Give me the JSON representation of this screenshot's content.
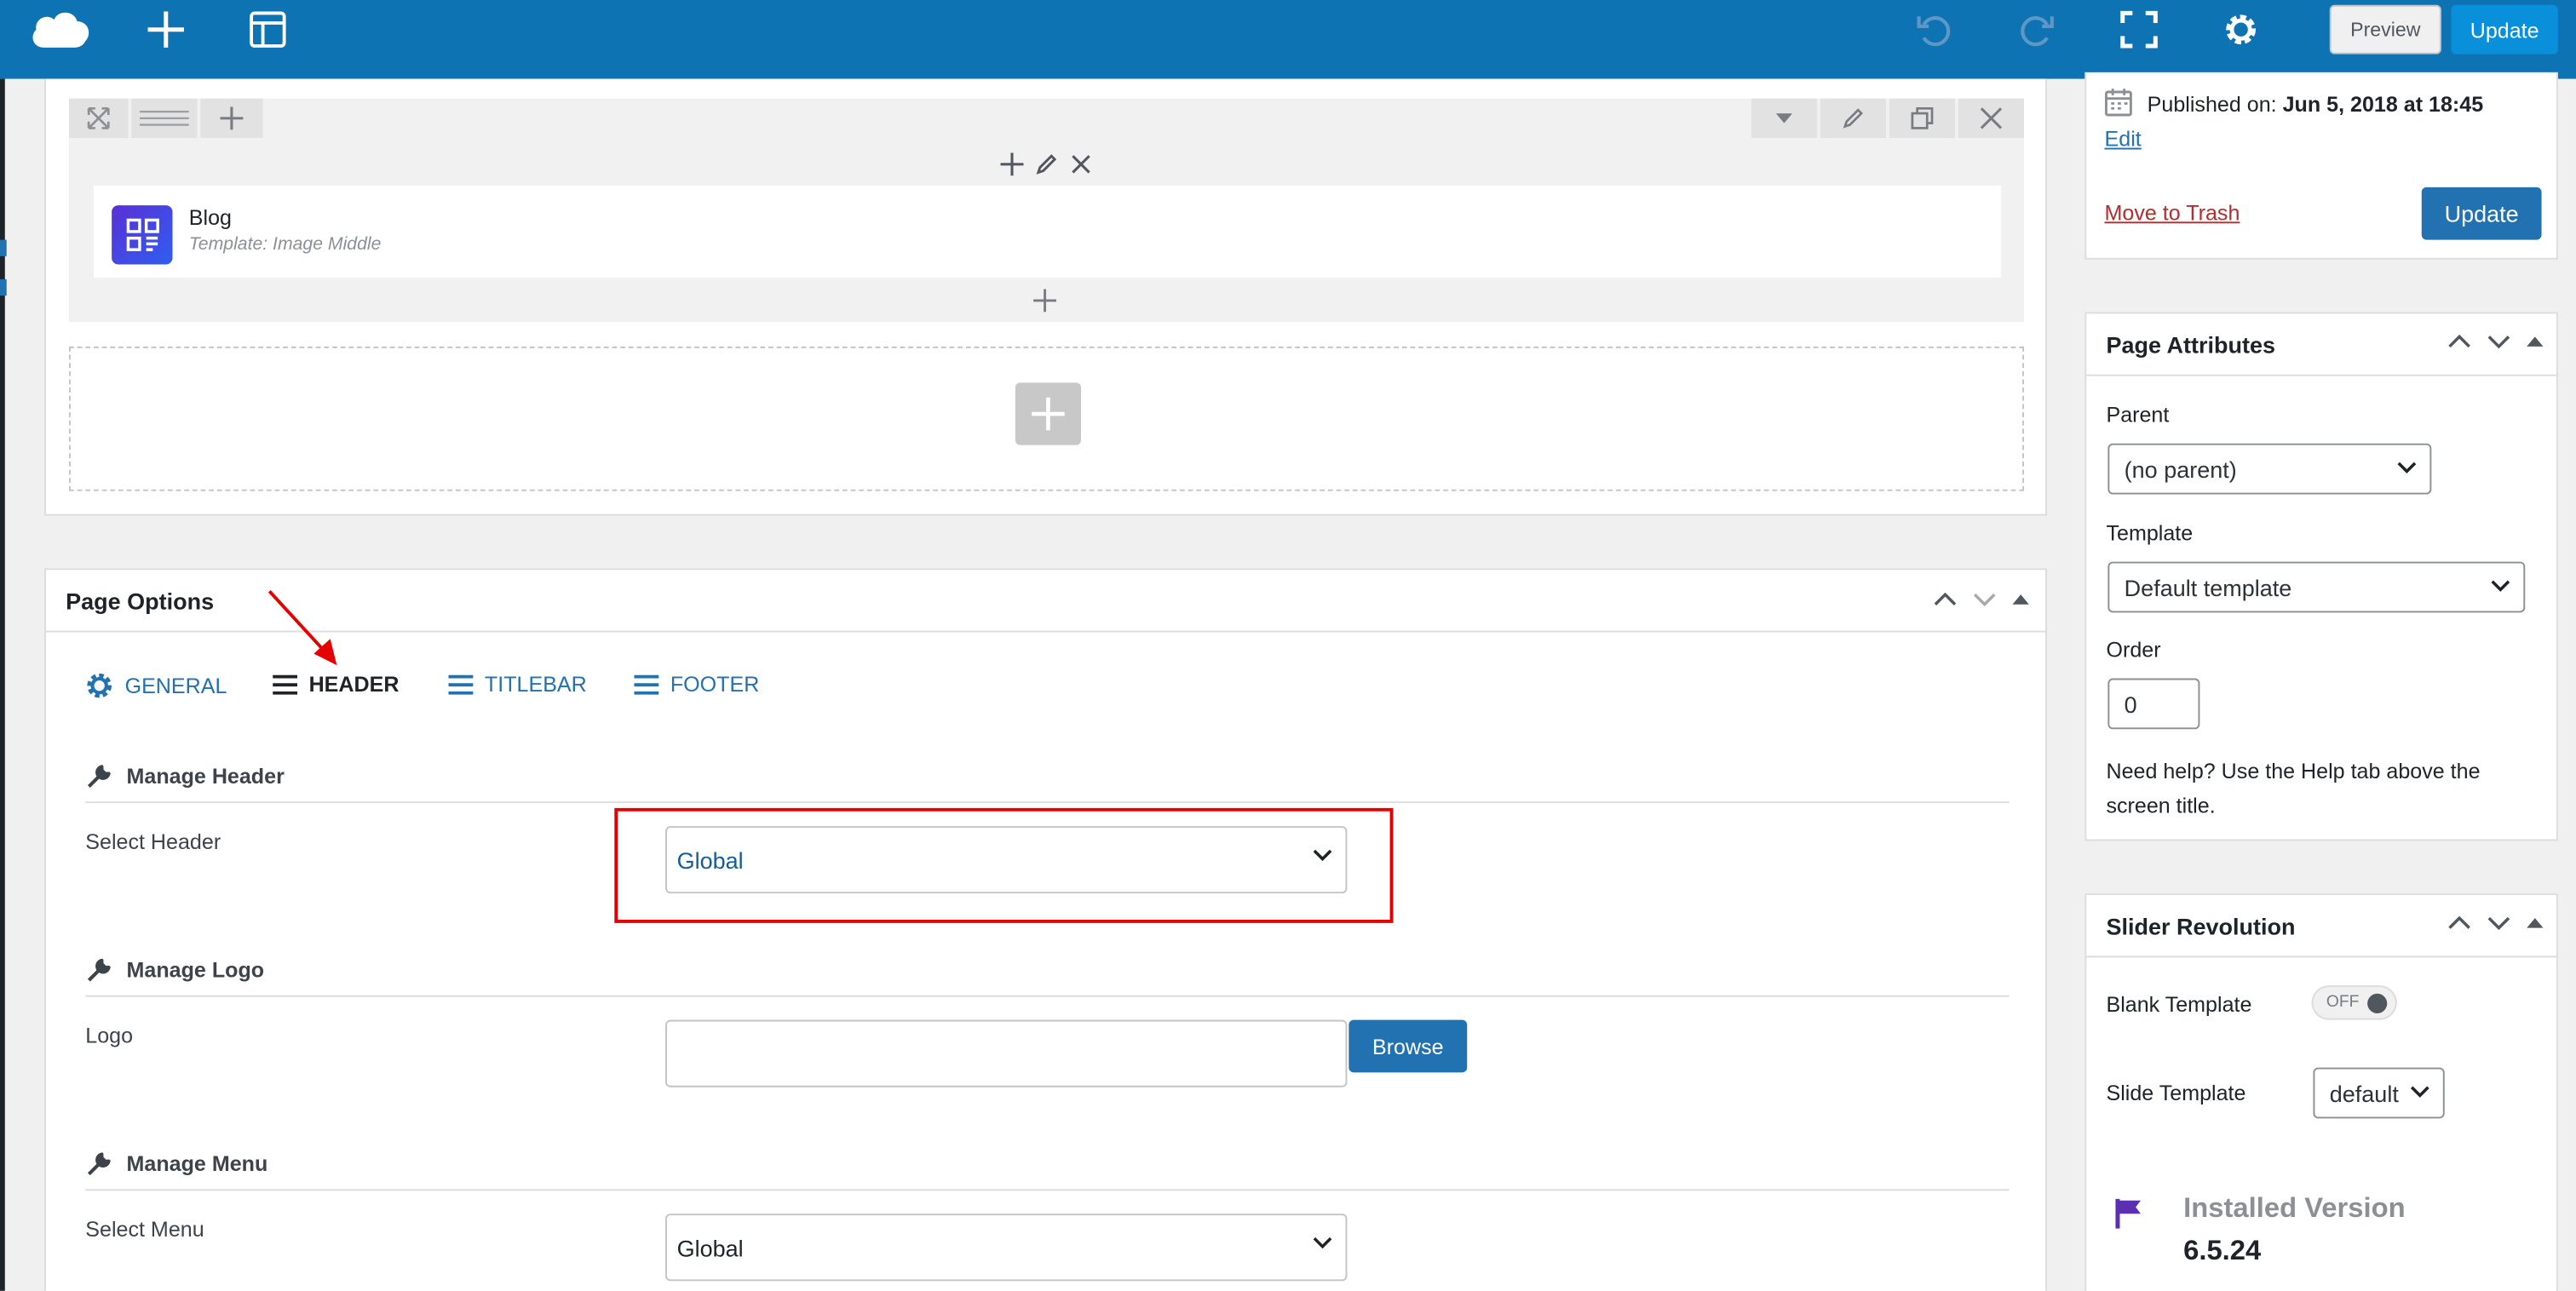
{
  "topbar": {
    "preview_label": "Preview",
    "update_label": "Update"
  },
  "builder": {
    "module": {
      "title": "Blog",
      "template": "Template: Image Middle"
    }
  },
  "page_options": {
    "title": "Page Options",
    "tabs": [
      {
        "label": "GENERAL",
        "icon": "gear-icon"
      },
      {
        "label": "HEADER",
        "icon": "menu-icon",
        "active": true
      },
      {
        "label": "TITLEBAR",
        "icon": "menu-icon"
      },
      {
        "label": "FOOTER",
        "icon": "menu-icon"
      }
    ],
    "sections": {
      "header": {
        "title": "Manage Header",
        "field_label": "Select Header",
        "value": "Global"
      },
      "logo": {
        "title": "Manage Logo",
        "field_label": "Logo",
        "value": "",
        "browse_label": "Browse"
      },
      "menu": {
        "title": "Manage Menu",
        "field_label": "Select Menu",
        "value": "Global"
      }
    }
  },
  "publish": {
    "published_label": "Published on:",
    "published_date": "Jun 5, 2018 at 18:45",
    "edit_label": "Edit",
    "trash_label": "Move to Trash",
    "update_label": "Update"
  },
  "page_attributes": {
    "title": "Page Attributes",
    "parent_label": "Parent",
    "parent_value": "(no parent)",
    "template_label": "Template",
    "template_value": "Default template",
    "order_label": "Order",
    "order_value": "0",
    "help_text": "Need help? Use the Help tab above the screen title."
  },
  "slider_revolution": {
    "title": "Slider Revolution",
    "blank_template_label": "Blank Template",
    "toggle_value": "OFF",
    "slide_template_label": "Slide Template",
    "slide_template_value": "default",
    "installed_version_label": "Installed Version",
    "installed_version_value": "6.5.24"
  },
  "colors": {
    "topbar": "#0e73b2",
    "primary_button": "#2271b1",
    "link": "#2271b1",
    "trash": "#b32d2e",
    "highlight": "#e60000",
    "flag": "#5b2fb0"
  }
}
